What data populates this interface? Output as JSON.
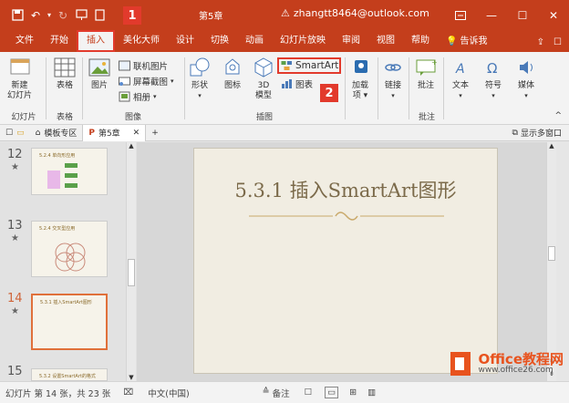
{
  "titlebar": {
    "doc_name": "第5章",
    "user": "zhangtt8464@outlook.com",
    "warning_icon": "warning-icon"
  },
  "callouts": {
    "one": "1",
    "two": "2"
  },
  "tabs": [
    {
      "label": "文件"
    },
    {
      "label": "开始"
    },
    {
      "label": "插入"
    },
    {
      "label": "美化大师"
    },
    {
      "label": "设计"
    },
    {
      "label": "切换"
    },
    {
      "label": "动画"
    },
    {
      "label": "幻灯片放映"
    },
    {
      "label": "审阅"
    },
    {
      "label": "视图"
    },
    {
      "label": "帮助"
    }
  ],
  "tellme": "告诉我",
  "ribbon": {
    "slides": {
      "new_slide_l1": "新建",
      "new_slide_l2": "幻灯片",
      "group": "幻灯片"
    },
    "tables": {
      "table": "表格",
      "group": "表格"
    },
    "images": {
      "picture": "图片",
      "online": "联机图片",
      "screenshot": "屏幕截图",
      "album": "相册",
      "group": "图像"
    },
    "illustrations": {
      "shapes": "形状",
      "icons": "图标",
      "model_l1": "3D",
      "model_l2": "模型",
      "smartart": "SmartArt",
      "chart": "图表",
      "group": "插图"
    },
    "addins": {
      "l1": "加载",
      "l2": "项"
    },
    "links": {
      "label": "链接"
    },
    "comments": {
      "label": "批注",
      "group": "批注"
    },
    "text": {
      "label": "文本"
    },
    "symbols": {
      "label": "符号"
    },
    "media": {
      "label": "媒体"
    }
  },
  "docbar": {
    "tab1": "模板专区",
    "tab2": "第5章",
    "right": "显示多窗口"
  },
  "thumbnails": [
    {
      "num": "12",
      "title": "5.2.4  单向形应用"
    },
    {
      "num": "13",
      "title": "5.2.4  交叉型应用"
    },
    {
      "num": "14",
      "title": "5.3.1  插入SmartArt图形"
    },
    {
      "num": "15",
      "title": "5.3.2  设置SmartArt的格式"
    }
  ],
  "slide": {
    "title": "5.3.1  插入SmartArt图形"
  },
  "status": {
    "slide_count": "幻灯片 第 14 张，共 23 张",
    "language": "中文(中国)",
    "notes": "备注"
  },
  "watermark": {
    "brand": "Office教程网",
    "url": "www.office26.com"
  },
  "colors": {
    "accent": "#c43e1c",
    "highlight": "#e23a2c",
    "slide_title": "#7b6a4a"
  }
}
